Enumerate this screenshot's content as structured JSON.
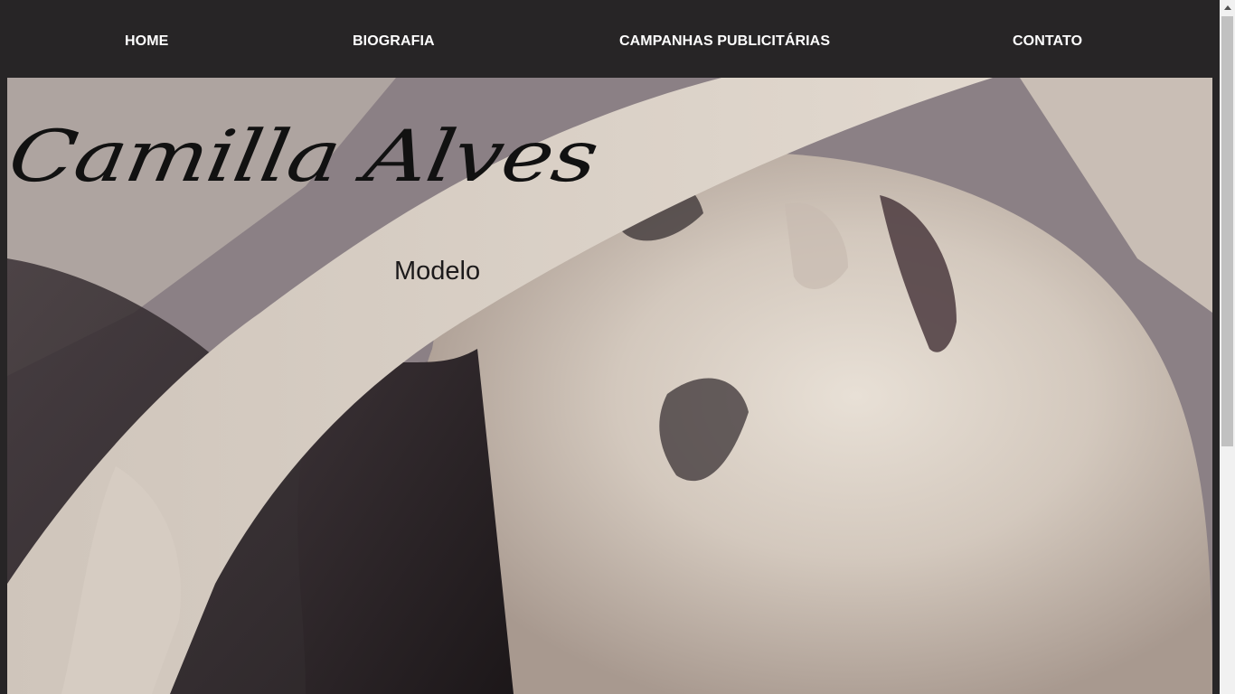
{
  "nav": {
    "items": [
      {
        "label": "HOME"
      },
      {
        "label": "BIOGRAFIA"
      },
      {
        "label": "CAMPANHAS PUBLICITÁRIAS"
      },
      {
        "label": "CONTATO"
      }
    ]
  },
  "hero": {
    "logo_name": "Camilla Alves",
    "logo_subtitle": "Modelo",
    "photo_icon": "portrait-photo"
  },
  "colors": {
    "nav_background": "#272526",
    "nav_text": "#ffffff",
    "photo_tone": "#cfc4ba"
  }
}
